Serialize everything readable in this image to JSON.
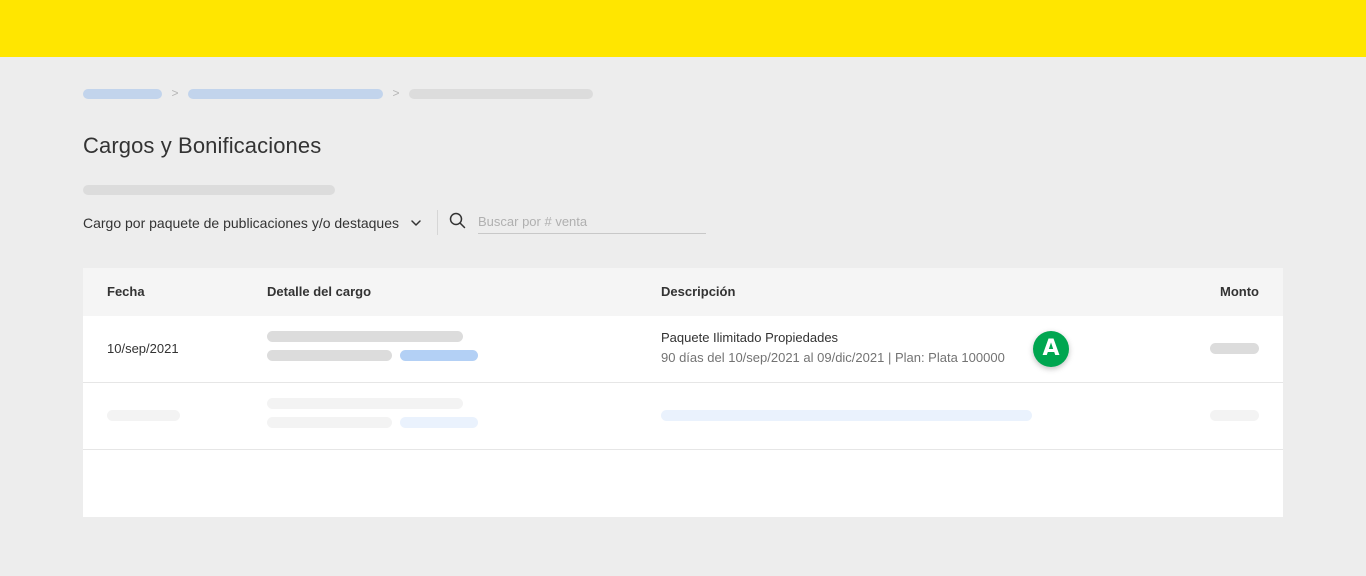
{
  "header": {
    "bar_color": "#ffe600"
  },
  "breadcrumb": {
    "separator": ">"
  },
  "page": {
    "title": "Cargos y Bonificaciones"
  },
  "filters": {
    "charge_type": "Cargo por paquete de publicaciones y/o destaques",
    "search_placeholder": "Buscar por # venta"
  },
  "table": {
    "columns": [
      "Fecha",
      "Detalle del cargo",
      "Descripción",
      "Monto"
    ],
    "rows": [
      {
        "date": "10/sep/2021",
        "description_title": "Paquete Ilimitado Propiedades",
        "description_detail": "90 días del 10/sep/2021 al 09/dic/2021 | Plan: Plata 100000"
      }
    ]
  },
  "annotation": {
    "label": "A",
    "color": "#00a650"
  }
}
